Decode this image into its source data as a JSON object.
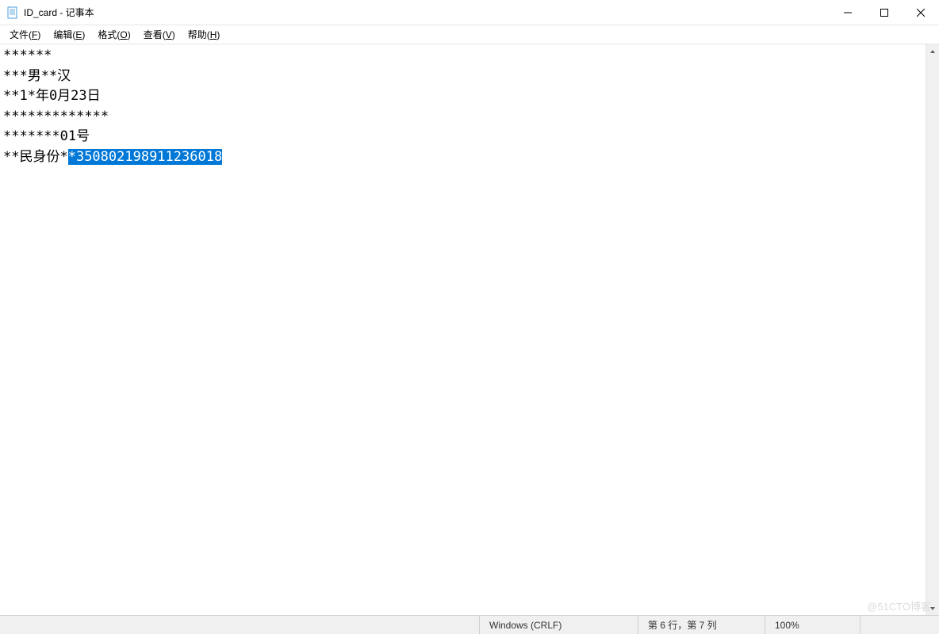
{
  "titlebar": {
    "title": "ID_card - 记事本"
  },
  "menubar": {
    "items": [
      {
        "label": "文件(",
        "key": "F",
        "suffix": ")"
      },
      {
        "label": "编辑(",
        "key": "E",
        "suffix": ")"
      },
      {
        "label": "格式(",
        "key": "O",
        "suffix": ")"
      },
      {
        "label": "查看(",
        "key": "V",
        "suffix": ")"
      },
      {
        "label": "帮助(",
        "key": "H",
        "suffix": ")"
      }
    ]
  },
  "content": {
    "line1": "******",
    "line2": "***男**汉",
    "line3": "**1*年0月23日",
    "line4": "*************",
    "line5": "*******01号",
    "line6_prefix": "**民身份*",
    "line6_selected": "*350802198911236018"
  },
  "statusbar": {
    "encoding": "Windows (CRLF)",
    "position": "第 6 行，第 7 列",
    "zoom": "100%"
  },
  "watermark": "@51CTO博客"
}
